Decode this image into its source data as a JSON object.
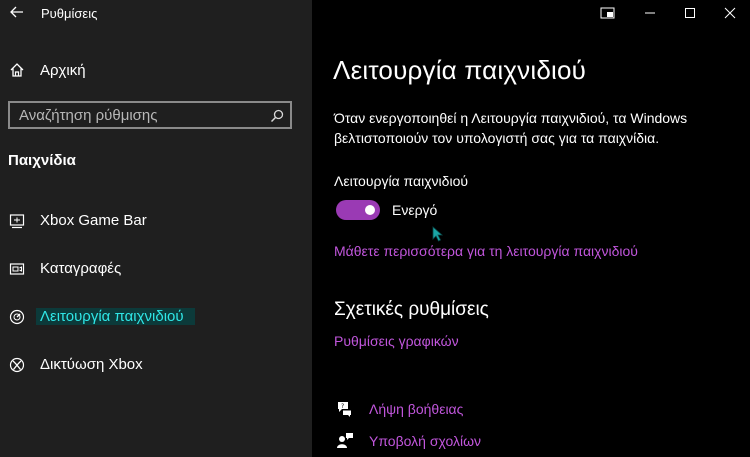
{
  "window": {
    "title": "Ρυθμίσεις"
  },
  "sidebar": {
    "home_label": "Αρχική",
    "search_placeholder": "Αναζήτηση ρύθμισης",
    "section_title": "Παιχνίδια",
    "items": [
      {
        "label": "Xbox Game Bar",
        "icon": "gamebar-icon"
      },
      {
        "label": "Καταγραφές",
        "icon": "captures-icon"
      },
      {
        "label": "Λειτουργία παιχνιδιού",
        "icon": "game-mode-icon",
        "active": true
      },
      {
        "label": "Δικτύωση Xbox",
        "icon": "xbox-icon"
      }
    ]
  },
  "main": {
    "title": "Λειτουργία παιχνιδιού",
    "description": "Όταν ενεργοποιηθεί η Λειτουργία παιχνιδιού, τα Windows βελτιστοποιούν τον υπολογιστή σας για τα παιχνίδια.",
    "toggle_label": "Λειτουργία παιχνιδιού",
    "toggle_state": "Ενεργό",
    "toggle_on": true,
    "learn_more_link": "Μάθετε περισσότερα για τη λειτουργία παιχνιδιού",
    "related_heading": "Σχετικές ρυθμίσεις",
    "graphics_link": "Ρυθμίσεις γραφικών",
    "help_link": "Λήψη βοήθειας",
    "feedback_link": "Υποβολή σχολίων"
  },
  "colors": {
    "accent": "#c156dc",
    "toggle": "#9a3ab4",
    "active_nav_text": "#2fe6e6",
    "sidebar_bg": "#1f1f1f",
    "main_bg": "#000000"
  }
}
